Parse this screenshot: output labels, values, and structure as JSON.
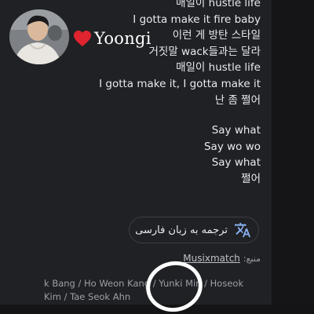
{
  "header": {
    "name": "Yoongi"
  },
  "lyrics": {
    "lines": [
      "매일이 hustle life",
      "I gotta make it fire baby",
      "이런 게 방탄 스타일",
      "거짓말 wack들과는 달라",
      "매일이 hustle life",
      "I gotta make it, I gotta make it",
      "난 좀 쩔어"
    ],
    "lines_after_gap": [
      "Say what",
      "Say wo wo",
      "Say what",
      "쩔어"
    ]
  },
  "translate": {
    "label": "ترجمه به زبان فارسی",
    "icon": "translate-icon"
  },
  "source": {
    "prefix": "منبع:",
    "provider": "Musixmatch"
  },
  "credits": {
    "line1": "k Bang / Ho Weon Kang / Yunki Min / Hoseok",
    "line2": "Kim / Tae Seok Ahn"
  },
  "colors": {
    "background": "#202124",
    "text": "#e8eaed",
    "muted": "#9aa0a6",
    "heart": "#e0242f",
    "translate_accent": "#8ab4f8"
  }
}
